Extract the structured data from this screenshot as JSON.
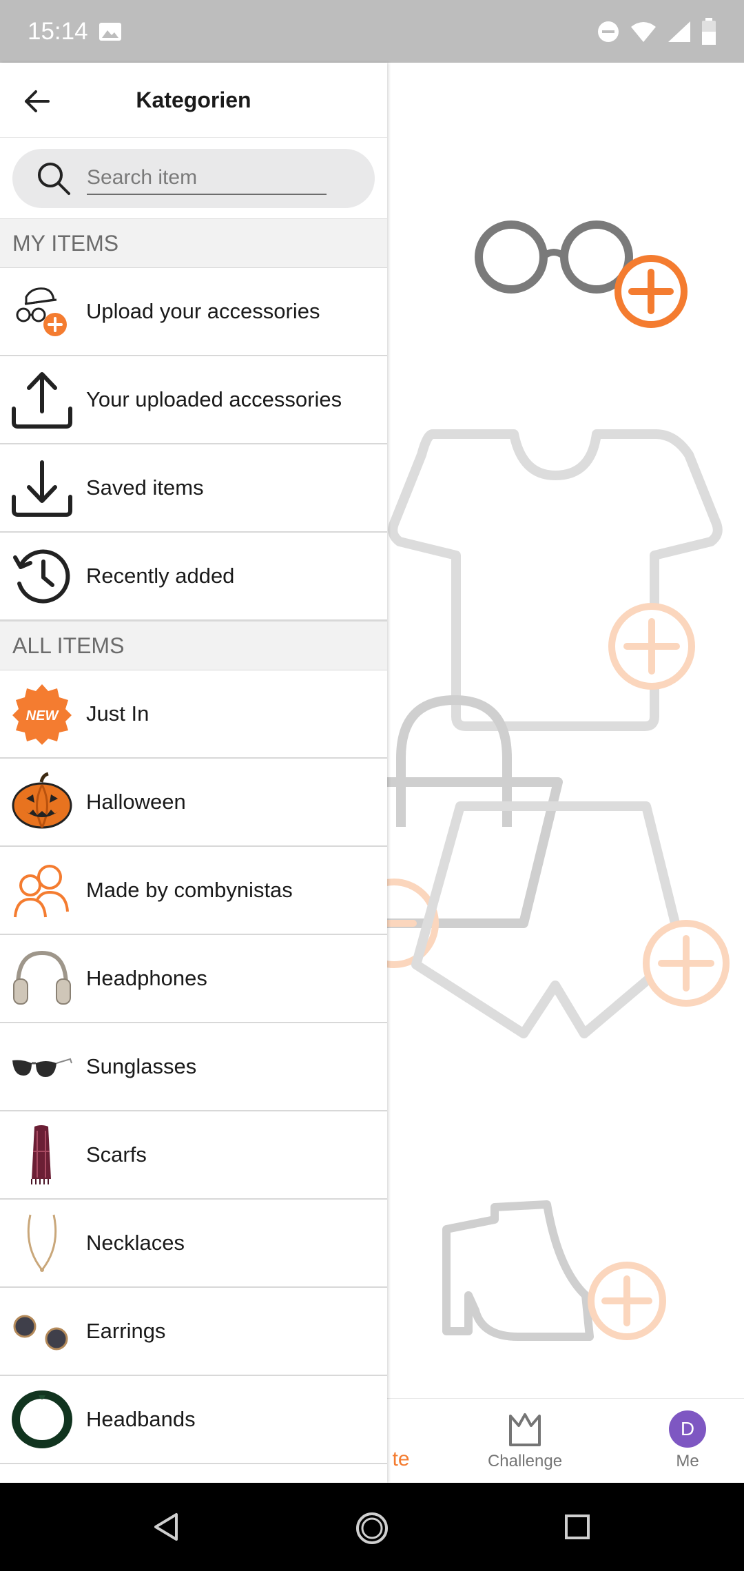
{
  "status_bar": {
    "time": "15:14"
  },
  "drawer": {
    "title": "Kategorien",
    "search": {
      "placeholder": "Search item"
    },
    "my_items": {
      "header": "MY ITEMS",
      "items": [
        {
          "label": "Upload your accessories",
          "icon": "upload-accessories-icon"
        },
        {
          "label": "Your uploaded accessories",
          "icon": "upload-icon"
        },
        {
          "label": "Saved items",
          "icon": "download-icon"
        },
        {
          "label": "Recently added",
          "icon": "history-icon"
        }
      ]
    },
    "all_items": {
      "header": "ALL ITEMS",
      "items": [
        {
          "label": "Just In",
          "icon": "new-badge-icon",
          "badge_text": "NEW"
        },
        {
          "label": "Halloween",
          "icon": "pumpkin-icon"
        },
        {
          "label": "Made by combynistas",
          "icon": "people-icon"
        },
        {
          "label": "Headphones",
          "icon": "headphones-icon"
        },
        {
          "label": "Sunglasses",
          "icon": "sunglasses-icon"
        },
        {
          "label": "Scarfs",
          "icon": "scarf-icon"
        },
        {
          "label": "Necklaces",
          "icon": "necklace-icon"
        },
        {
          "label": "Earrings",
          "icon": "earrings-icon"
        },
        {
          "label": "Headbands",
          "icon": "headband-icon"
        }
      ]
    }
  },
  "bottom_nav": {
    "create_label_visible": "te",
    "challenge_label": "Challenge",
    "me_label": "Me",
    "avatar_initial": "D"
  },
  "colors": {
    "accent": "#f47c30",
    "drawer_bg": "#ffffff",
    "section_bg": "#f2f2f2",
    "avatar": "#7e57c2"
  }
}
